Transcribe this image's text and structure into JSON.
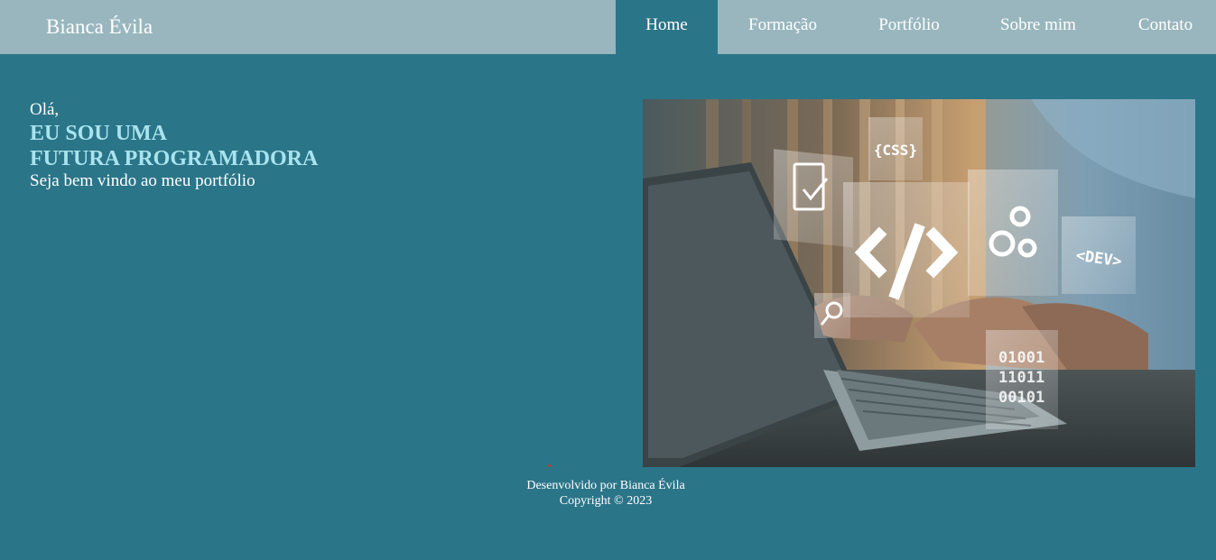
{
  "header": {
    "brand": "Bianca Évila",
    "nav": [
      {
        "label": "Home",
        "active": true
      },
      {
        "label": "Formação",
        "active": false
      },
      {
        "label": "Portfólio",
        "active": false
      },
      {
        "label": "Sobre mim",
        "active": false
      },
      {
        "label": "Contato",
        "active": false
      }
    ]
  },
  "hero": {
    "greeting": "Olá,",
    "headline_line1": "EU SOU UMA",
    "headline_line2": "FUTURA PROGRAMADORA",
    "tagline": "Seja bem vindo ao meu portfólio",
    "image": {
      "tags": [
        "{CSS}",
        "<DEV>",
        "01001",
        "11011",
        "00101"
      ],
      "icons": [
        "code-icon",
        "gears-icon",
        "checklist-icon",
        "magnifier-icon",
        "binary-icon"
      ]
    }
  },
  "footer": {
    "developed_by": "Desenvolvido por Bianca Évila",
    "copyright": "Copyright © 2023"
  },
  "colors": {
    "background": "#2b7589",
    "topbar": "#99b6be",
    "headline": "#a9e4ee"
  }
}
